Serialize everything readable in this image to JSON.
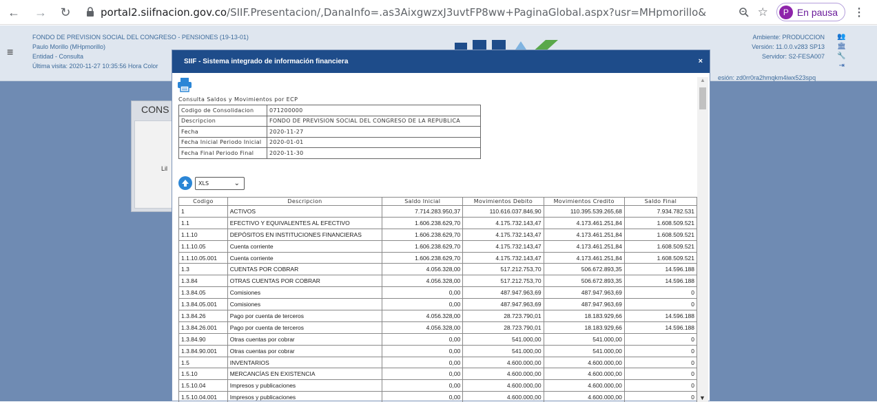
{
  "browser": {
    "url_host": "portal2.siifnacion.gov.co",
    "url_path": "/SIIF.Presentacion/,DanaInfo=.as3AixgwzxJ3uvtFP8ww+PaginaGlobal.aspx?usr=MHpmorillo&h...",
    "profile_initial": "P",
    "profile_label": "En pausa"
  },
  "header": {
    "entity_line": "FONDO DE PREVISION SOCIAL DEL CONGRESO - PENSIONES (19-13-01)",
    "user_line": "Paulo Morillo (MHpmorillo)",
    "role_line": "Entidad - Consulta",
    "last_visit": "Última visita: 2020-11-27 10:35:56 Hora Color",
    "environment": "Ambiente: PRODUCCION",
    "version": "Versión: 11.0.0.v283 SP13",
    "server": "Servidor: S2-FESA007",
    "session": "esión: zd0rr0ra2hmqkm4iwx523spq"
  },
  "background": {
    "card_title": "CONS",
    "card_text": "Lil"
  },
  "modal": {
    "title": "SIIF - Sistema integrado de información financiera",
    "close": "×",
    "report_title": "Consulta Saldos y Movimientos por ECP",
    "info": [
      {
        "key": "Codigo de Consolidacion",
        "value": "071200000"
      },
      {
        "key": "Descripcion",
        "value": "FONDO DE PREVISION SOCIAL DEL CONGRESO DE LA REPUBLICA"
      },
      {
        "key": "Fecha",
        "value": "2020-11-27"
      },
      {
        "key": "Fecha Inicial Periodo Inicial",
        "value": "2020-01-01"
      },
      {
        "key": "Fecha Final Periodo Final",
        "value": "2020-11-30"
      }
    ],
    "export_format": "XLS",
    "columns": [
      "Codigo",
      "Descripcion",
      "Saldo Inicial",
      "Movimientos Debito",
      "Movimientos Credito",
      "Saldo Final"
    ],
    "rows": [
      [
        "1",
        "ACTIVOS",
        "7.714.283.950,37",
        "110.616.037.846,90",
        "110.395.539.265,68",
        "7.934.782.531"
      ],
      [
        "1.1",
        "EFECTIVO Y EQUIVALENTES AL EFECTIVO",
        "1.606.238.629,70",
        "4.175.732.143,47",
        "4.173.461.251,84",
        "1.608.509.521"
      ],
      [
        "1.1.10",
        "DEPÓSITOS EN INSTITUCIONES FINANCIERAS",
        "1.606.238.629,70",
        "4.175.732.143,47",
        "4.173.461.251,84",
        "1.608.509.521"
      ],
      [
        "1.1.10.05",
        "Cuenta corriente",
        "1.606.238.629,70",
        "4.175.732.143,47",
        "4.173.461.251,84",
        "1.608.509.521"
      ],
      [
        "1.1.10.05.001",
        "Cuenta corriente",
        "1.606.238.629,70",
        "4.175.732.143,47",
        "4.173.461.251,84",
        "1.608.509.521"
      ],
      [
        "1.3",
        "CUENTAS POR COBRAR",
        "4.056.328,00",
        "517.212.753,70",
        "506.672.893,35",
        "14.596.188"
      ],
      [
        "1.3.84",
        "OTRAS CUENTAS POR COBRAR",
        "4.056.328,00",
        "517.212.753,70",
        "506.672.893,35",
        "14.596.188"
      ],
      [
        "1.3.84.05",
        "Comisiones",
        "0,00",
        "487.947.963,69",
        "487.947.963,69",
        "0"
      ],
      [
        "1.3.84.05.001",
        "Comisiones",
        "0,00",
        "487.947.963,69",
        "487.947.963,69",
        "0"
      ],
      [
        "1.3.84.26",
        "Pago por cuenta de terceros",
        "4.056.328,00",
        "28.723.790,01",
        "18.183.929,66",
        "14.596.188"
      ],
      [
        "1.3.84.26.001",
        "Pago por cuenta de terceros",
        "4.056.328,00",
        "28.723.790,01",
        "18.183.929,66",
        "14.596.188"
      ],
      [
        "1.3.84.90",
        "Otras cuentas por cobrar",
        "0,00",
        "541.000,00",
        "541.000,00",
        "0"
      ],
      [
        "1.3.84.90.001",
        "Otras cuentas por cobrar",
        "0,00",
        "541.000,00",
        "541.000,00",
        "0"
      ],
      [
        "1.5",
        "INVENTARIOS",
        "0,00",
        "4.600.000,00",
        "4.600.000,00",
        "0"
      ],
      [
        "1.5.10",
        "MERCANCÍAS EN EXISTENCIA",
        "0,00",
        "4.600.000,00",
        "4.600.000,00",
        "0"
      ],
      [
        "1.5.10.04",
        "Impresos y publicaciones",
        "0,00",
        "4.600.000,00",
        "4.600.000,00",
        "0"
      ],
      [
        "1.5.10.04.001",
        "Impresos y publicaciones",
        "0,00",
        "4.600.000,00",
        "4.600.000,00",
        "0"
      ]
    ]
  },
  "colors": {
    "modal_header": "#1e4c8a",
    "page_background": "#6f8bb3",
    "header_text": "#3c6a9a"
  }
}
